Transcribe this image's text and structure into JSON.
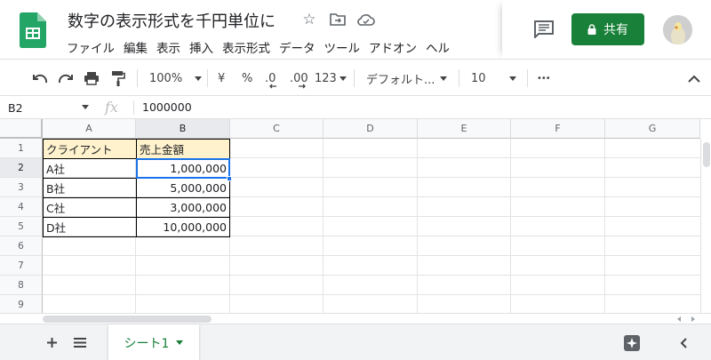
{
  "header": {
    "doc_title": "数字の表示形式を千円単位に",
    "menu": [
      "ファイル",
      "編集",
      "表示",
      "挿入",
      "表示形式",
      "データ",
      "ツール",
      "アドオン",
      "ヘル"
    ],
    "share_label": "共有"
  },
  "toolbar": {
    "zoom": "100%",
    "currency": "¥",
    "percent": "%",
    "decimal_decrease": ".0",
    "decimal_increase": ".00",
    "more_formats": "123",
    "font": "デフォルト...",
    "font_size": "10",
    "more": "•••"
  },
  "formula_bar": {
    "cell_ref": "B2",
    "fx": "fx",
    "value": "1000000"
  },
  "grid": {
    "columns": [
      "A",
      "B",
      "C",
      "D",
      "E",
      "F",
      "G"
    ],
    "rows": [
      "1",
      "2",
      "3",
      "4",
      "5",
      "6",
      "7",
      "8",
      "9"
    ],
    "table_header": [
      "クライアント",
      "売上金額"
    ],
    "table_rows": [
      [
        "A社",
        "1,000,000"
      ],
      [
        "B社",
        "5,000,000"
      ],
      [
        "C社",
        "3,000,000"
      ],
      [
        "D社",
        "10,000,000"
      ]
    ],
    "selected_cell": "B2"
  },
  "sheets": {
    "active_tab": "シート1"
  },
  "colors": {
    "brand_green": "#188038",
    "header_fill": "#fff2cc",
    "selection_blue": "#1a73e8"
  }
}
